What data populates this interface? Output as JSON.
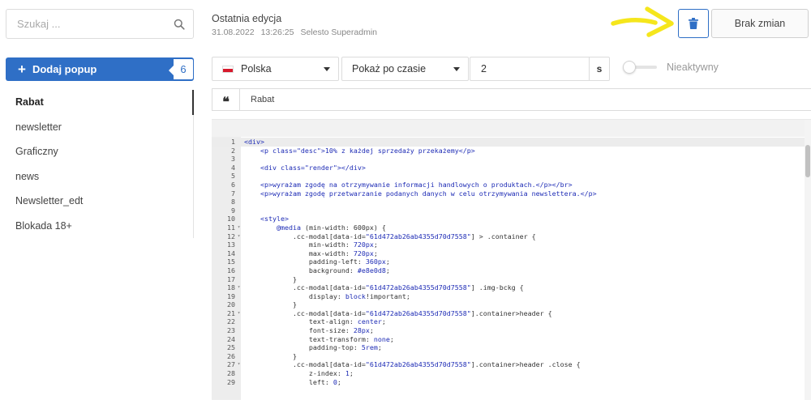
{
  "search": {
    "placeholder": "Szukaj ...",
    "icon": "search-icon"
  },
  "sidebar": {
    "add_button_label": "Dodaj popup",
    "count": "6",
    "items": [
      {
        "label": "Rabat",
        "active": true
      },
      {
        "label": "newsletter"
      },
      {
        "label": "Graficzny"
      },
      {
        "label": "news"
      },
      {
        "label": "Newsletter_edt"
      },
      {
        "label": "Blokada 18+"
      }
    ]
  },
  "header": {
    "edit_title": "Ostatnia edycja",
    "edit_date": "31.08.2022",
    "edit_time": "13:26:25",
    "edit_user": "Selesto Superadmin",
    "no_changes_label": "Brak zmian",
    "accent_color": "#2f6fc6",
    "annotation_color": "#f5e61c"
  },
  "settings": {
    "language": "Polska",
    "display_mode": "Pokaż po czasie",
    "delay_value": "2",
    "delay_unit": "s",
    "status_label": "Nieaktywny",
    "popup_title": "Rabat"
  },
  "editor": {
    "lines": [
      {
        "n": "1",
        "fold": "",
        "html": "<span class='tag'>&lt;div&gt;</span>"
      },
      {
        "n": "2",
        "fold": "",
        "html": "    <span class='tag'>&lt;p class=\"desc\"&gt;10% z każdej sprzedaży przekażemy&lt;/p&gt;</span>"
      },
      {
        "n": "3",
        "fold": "",
        "html": ""
      },
      {
        "n": "4",
        "fold": "",
        "html": "    <span class='tag'>&lt;div class=\"render\"&gt;&lt;/div&gt;</span>"
      },
      {
        "n": "5",
        "fold": "",
        "html": ""
      },
      {
        "n": "6",
        "fold": "",
        "html": "    <span class='tag'>&lt;p&gt;wyrażam zgodę na otrzymywanie informacji handlowych o produktach.&lt;/p&gt;&lt;/br&gt;</span>"
      },
      {
        "n": "7",
        "fold": "",
        "html": "    <span class='tag'>&lt;p&gt;wyrażam zgodę przetwarzanie podanych danych w celu otrzymywania newslettera.&lt;/p&gt;</span>"
      },
      {
        "n": "8",
        "fold": "",
        "html": ""
      },
      {
        "n": "9",
        "fold": "",
        "html": ""
      },
      {
        "n": "10",
        "fold": "",
        "html": "    <span class='tag'>&lt;style&gt;</span>"
      },
      {
        "n": "11",
        "fold": "▾",
        "html": "        <span class='css-kw'>@media</span> (min-width: 600px) {"
      },
      {
        "n": "12",
        "fold": "▾",
        "html": "            .cc-modal[data-id=<span class='str'>\"61d472ab26ab4355d70d7558\"</span>] &gt; .container {"
      },
      {
        "n": "13",
        "fold": "",
        "html": "                min-width: <span class='css-val'>720px</span>;"
      },
      {
        "n": "14",
        "fold": "",
        "html": "                max-width: <span class='css-val'>720px</span>;"
      },
      {
        "n": "15",
        "fold": "",
        "html": "                padding-left: <span class='css-val'>360px</span>;"
      },
      {
        "n": "16",
        "fold": "",
        "html": "                background: <span class='css-val'>#e8e0d8</span>;"
      },
      {
        "n": "17",
        "fold": "",
        "html": "            }"
      },
      {
        "n": "18",
        "fold": "▾",
        "html": "            .cc-modal[data-id=<span class='str'>\"61d472ab26ab4355d70d7558\"</span>] .img-bckg {"
      },
      {
        "n": "19",
        "fold": "",
        "html": "                display: <span class='css-val'>block</span>!important;"
      },
      {
        "n": "20",
        "fold": "",
        "html": "            }"
      },
      {
        "n": "21",
        "fold": "▾",
        "html": "            .cc-modal[data-id=<span class='str'>\"61d472ab26ab4355d70d7558\"</span>].container&gt;header {"
      },
      {
        "n": "22",
        "fold": "",
        "html": "                text-align: <span class='css-val'>center</span>;"
      },
      {
        "n": "23",
        "fold": "",
        "html": "                font-size: <span class='css-val'>28px</span>;"
      },
      {
        "n": "24",
        "fold": "",
        "html": "                text-transform: <span class='css-val'>none</span>;"
      },
      {
        "n": "25",
        "fold": "",
        "html": "                padding-top: <span class='css-val'>5rem</span>;"
      },
      {
        "n": "26",
        "fold": "",
        "html": "            }"
      },
      {
        "n": "27",
        "fold": "▾",
        "html": "            .cc-modal[data-id=<span class='str'>\"61d472ab26ab4355d70d7558\"</span>].container&gt;header .close {"
      },
      {
        "n": "28",
        "fold": "",
        "html": "                z-index: <span class='css-val'>1</span>;"
      },
      {
        "n": "29",
        "fold": "",
        "html": "                left: <span class='css-val'>0</span>;"
      }
    ]
  }
}
